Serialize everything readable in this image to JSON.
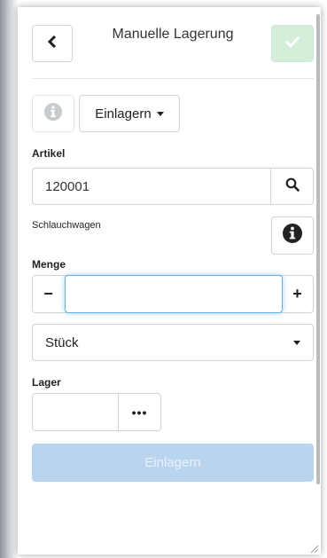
{
  "header": {
    "title": "Manuelle Lagerung",
    "back_icon": "chevron-left-icon",
    "confirm_icon": "check-icon",
    "accent_color": "#d4eed9"
  },
  "toolbar": {
    "info_icon": "info-circle-icon",
    "mode_label": "Einlagern"
  },
  "artikel": {
    "label": "Artikel",
    "value": "120001",
    "search_icon": "search-icon",
    "name": "Schlauchwagen",
    "info_icon": "info-circle-icon"
  },
  "menge": {
    "label": "Menge",
    "minus": "−",
    "plus": "+",
    "value": "",
    "unit": "Stück"
  },
  "lager": {
    "label": "Lager",
    "value": "",
    "more": "•••"
  },
  "submit": {
    "label": "Einlagern",
    "color": "#b9d4ee"
  }
}
